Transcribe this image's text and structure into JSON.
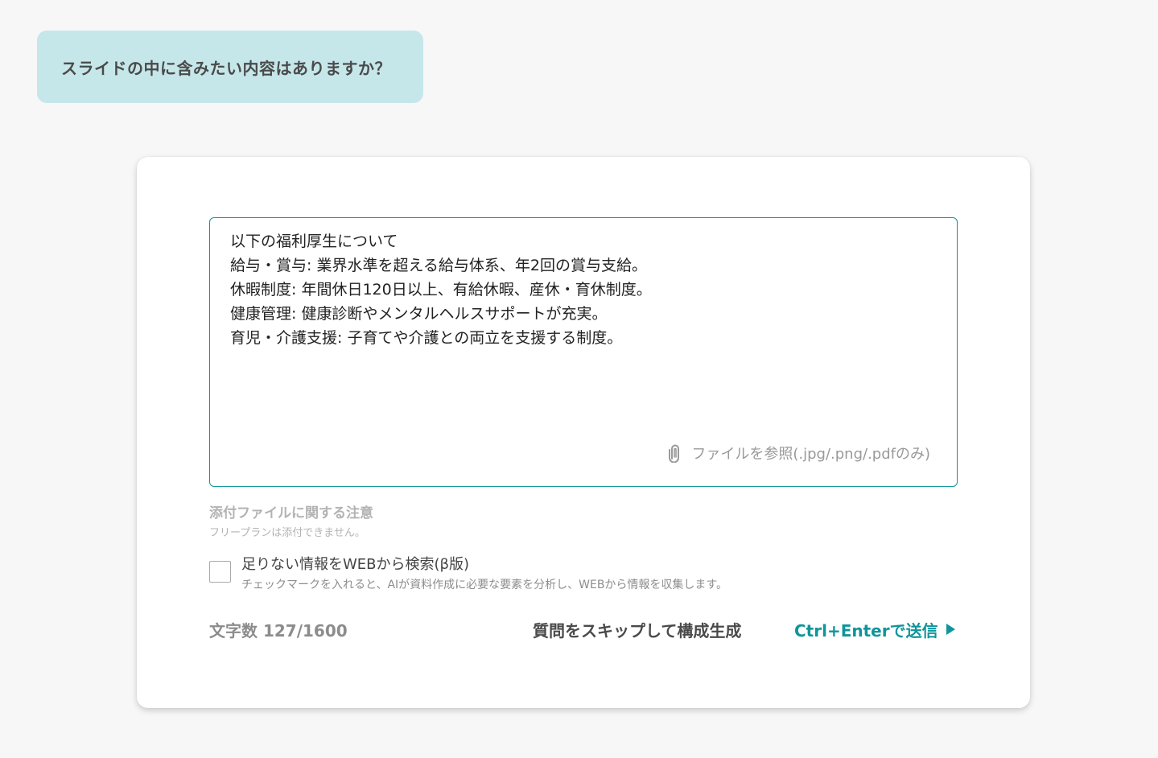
{
  "question": {
    "text": "スライドの中に含みたい内容はありますか？"
  },
  "editor": {
    "lines": [
      "以下の福利厚生について",
      "給与・賞与: 業界水準を超える給与体系、年2回の賞与支給。",
      "休暇制度: 年間休日120日以上、有給休暇、産休・育休制度。",
      "健康管理: 健康診断やメンタルヘルスサポートが充実。",
      "育児・介護支援: 子育てや介護との両立を支援する制度。"
    ],
    "attach_label": "ファイルを参照(.jpg/.png/.pdfのみ)",
    "attach_icon": "paperclip-icon"
  },
  "attachment_note": {
    "title": "添付ファイルに関する注意",
    "body": "フリープランは添付できません。"
  },
  "web_search": {
    "label": "足りない情報をWEBから検索(β版)",
    "description": "チェックマークを入れると、AIが資料作成に必要な要素を分析し、WEBから情報を収集します。",
    "checked": false
  },
  "footer": {
    "char_count": "文字数 127/1600",
    "skip_label": "質問をスキップして構成生成",
    "send_label": "Ctrl+Enterで送信",
    "send_icon": "play-icon"
  },
  "colors": {
    "accent": "#0f959b",
    "bubble": "#c6e7ea",
    "background": "#f7f7f7"
  }
}
